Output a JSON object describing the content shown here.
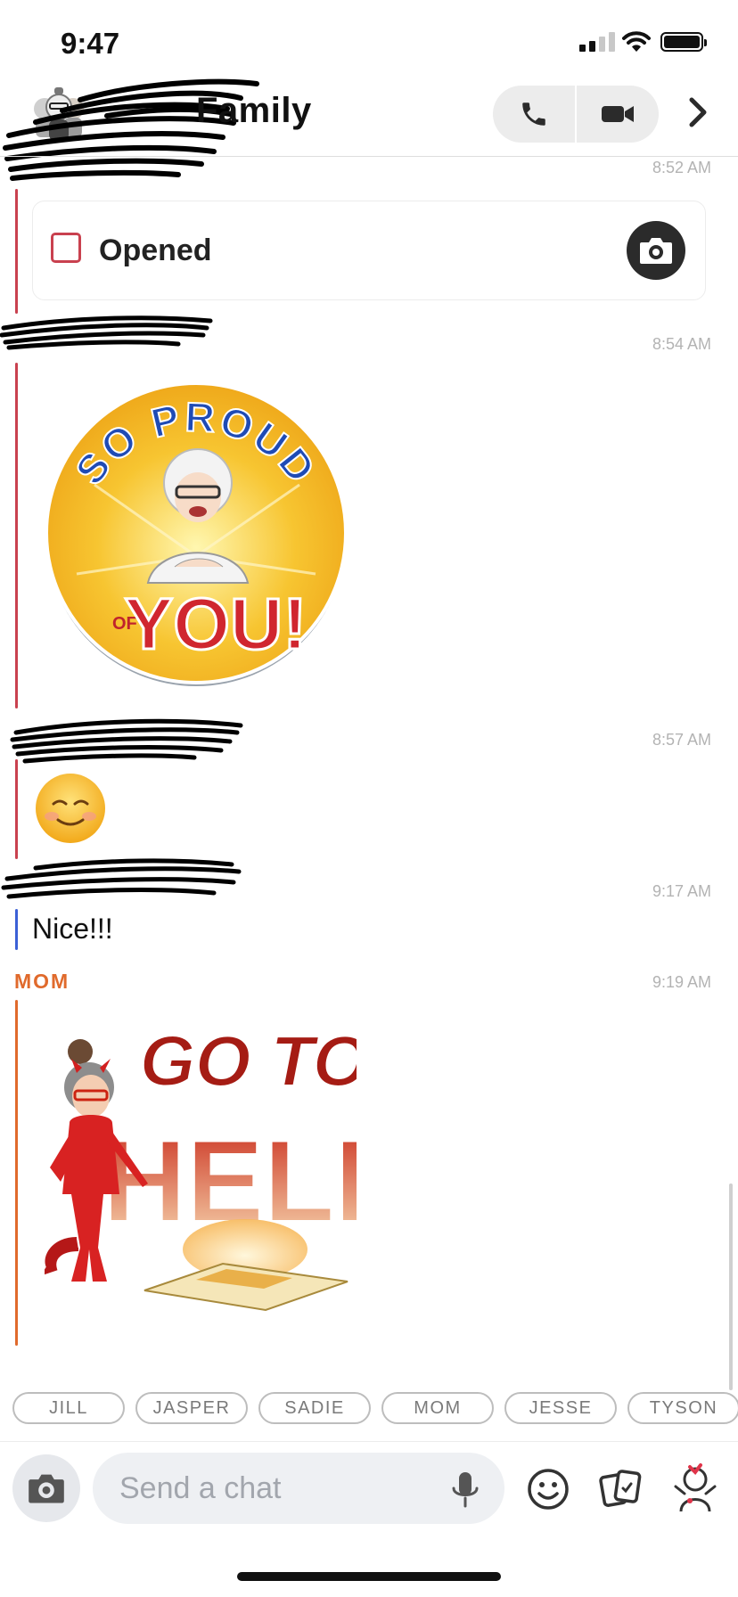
{
  "status_bar": {
    "time": "9:47"
  },
  "header": {
    "title": "Family"
  },
  "messages": {
    "ts1": "8:52 AM",
    "opened_label": "Opened",
    "ts2": "8:54 AM",
    "sticker1": {
      "top_text": "SO PROUD",
      "small_text": "OF",
      "big_text": "YOU!"
    },
    "ts3": "8:57 AM",
    "emoji": "☺️",
    "ts4": "9:17 AM",
    "nice_text": "Nice!!!",
    "mom_name": "MOM",
    "ts5": "9:19 AM",
    "sticker2": {
      "line1": "GO TO",
      "line2": "HELL"
    }
  },
  "chips": [
    "JILL",
    "JASPER",
    "SADIE",
    "MOM",
    "JESSE",
    "TYSON"
  ],
  "composer": {
    "placeholder": "Send a chat"
  },
  "colors": {
    "red": "#c9414f",
    "blue": "#3b60d6",
    "orange": "#e06a2c"
  }
}
